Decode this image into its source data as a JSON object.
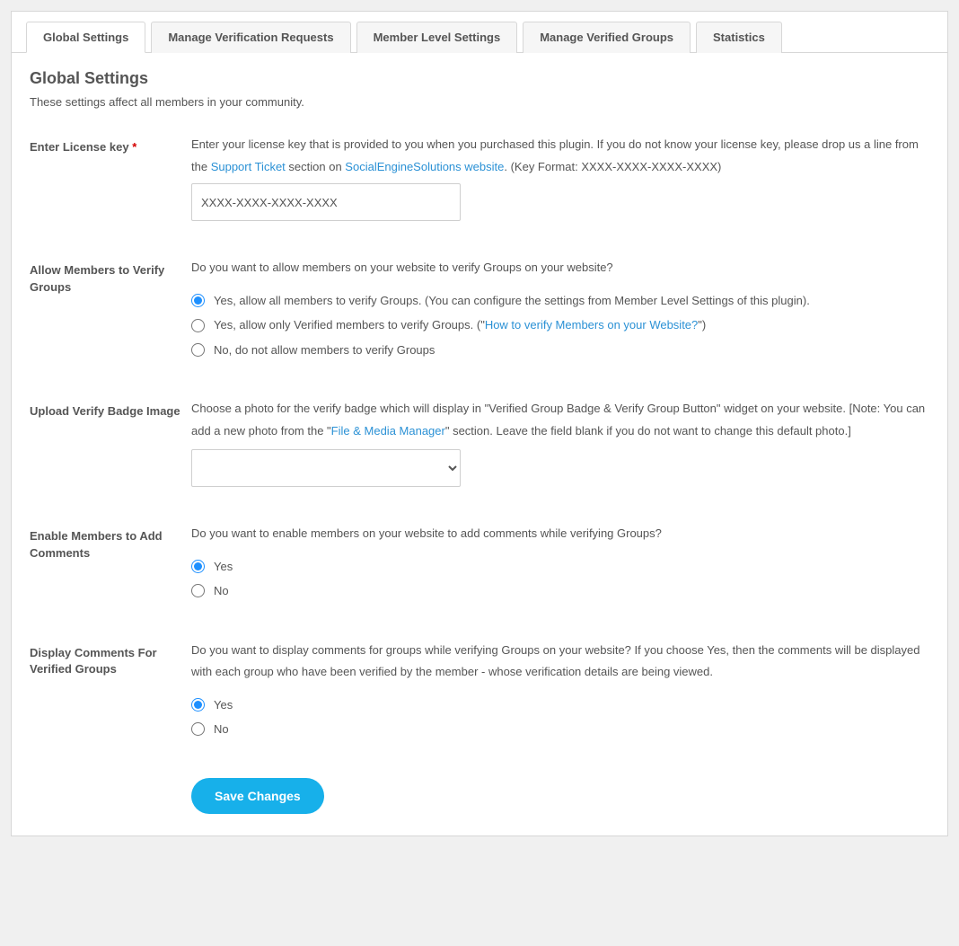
{
  "tabs": [
    {
      "label": "Global Settings",
      "active": true
    },
    {
      "label": "Manage Verification Requests",
      "active": false
    },
    {
      "label": "Member Level Settings",
      "active": false
    },
    {
      "label": "Manage Verified Groups",
      "active": false
    },
    {
      "label": "Statistics",
      "active": false
    }
  ],
  "page": {
    "title": "Global Settings",
    "description": "These settings affect all members in your community."
  },
  "fields": {
    "license": {
      "label": "Enter License key",
      "required_mark": "*",
      "desc_part1": "Enter your license key that is provided to you when you purchased this plugin. If you do not know your license key, please drop us a line from the ",
      "link1_text": "Support Ticket",
      "desc_part2": " section on ",
      "link2_text": "SocialEngineSolutions website",
      "desc_part3": ". (Key Format: XXXX-XXXX-XXXX-XXXX)",
      "value": "XXXX-XXXX-XXXX-XXXX"
    },
    "allow_verify": {
      "label": "Allow Members to Verify Groups",
      "desc": "Do you want to allow members on your website to verify Groups on your website?",
      "opt1": "Yes, allow all members to verify Groups. (You can configure the settings from Member Level Settings of this plugin).",
      "opt2_pre": "Yes, allow only Verified members to verify Groups. (\"",
      "opt2_link": "How to verify Members on your Website?",
      "opt2_post": "\")",
      "opt3": "No, do not allow members to verify Groups",
      "selected": 0
    },
    "badge": {
      "label": "Upload Verify Badge Image",
      "desc_part1": "Choose a photo for the verify badge which will display in \"Verified Group Badge & Verify Group Button\" widget on your website. [Note: You can add a new photo from the \"",
      "link_text": "File & Media Manager",
      "desc_part2": "\" section. Leave the field blank if you do not want to change this default photo.]"
    },
    "comments": {
      "label": "Enable Members to Add Comments",
      "desc": "Do you want to enable members on your website to add comments while verifying Groups?",
      "yes": "Yes",
      "no": "No",
      "selected": 0
    },
    "display_comments": {
      "label": "Display Comments For Verified Groups",
      "desc": "Do you want to display comments for groups while verifying Groups on your website? If you choose Yes, then the comments will be displayed with each group who have been verified by the member - whose verification details are being viewed.",
      "yes": "Yes",
      "no": "No",
      "selected": 0
    }
  },
  "buttons": {
    "save": "Save Changes"
  }
}
